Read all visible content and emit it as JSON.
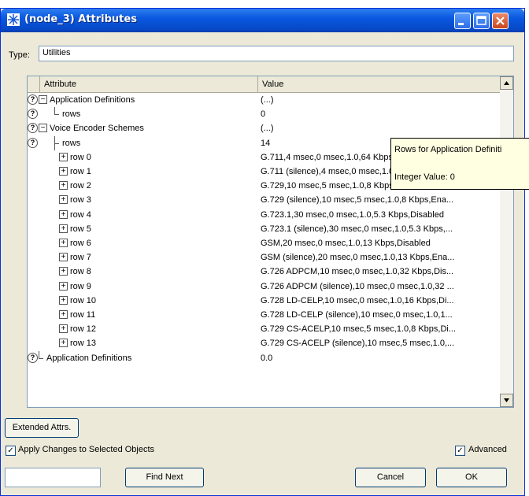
{
  "window": {
    "title": "(node_3) Attributes"
  },
  "type": {
    "label": "Type:",
    "value": "Utilities"
  },
  "table": {
    "header_attribute": "Attribute",
    "header_value": "Value",
    "rows": [
      {
        "label": "Application Definitions",
        "value": "(...)",
        "help": true,
        "toggle": "−"
      },
      {
        "label": "rows",
        "value": "0",
        "help": true
      },
      {
        "label": "Voice Encoder Schemes",
        "value": "(...)",
        "help": true,
        "toggle": "−"
      },
      {
        "label": "rows",
        "value": "14",
        "help": true
      },
      {
        "label": "row 0",
        "value": "G.711,4 msec,0 msec,1.0,64 Kbps,Disabled",
        "toggle": "+"
      },
      {
        "label": "row 1",
        "value": "G.711 (silence),4 msec,0 msec,1.0,64 Kbps,Ena...",
        "toggle": "+"
      },
      {
        "label": "row 2",
        "value": "G.729,10 msec,5 msec,1.0,8 Kbps,Disabled",
        "toggle": "+"
      },
      {
        "label": "row 3",
        "value": "G.729 (silence),10 msec,5 msec,1.0,8 Kbps,Ena...",
        "toggle": "+"
      },
      {
        "label": "row 4",
        "value": "G.723.1,30 msec,0 msec,1.0,5.3 Kbps,Disabled",
        "toggle": "+"
      },
      {
        "label": "row 5",
        "value": "G.723.1 (silence),30 msec,0 msec,1.0,5.3 Kbps,...",
        "toggle": "+"
      },
      {
        "label": "row 6",
        "value": "GSM,20 msec,0 msec,1.0,13 Kbps,Disabled",
        "toggle": "+"
      },
      {
        "label": "row 7",
        "value": "GSM (silence),20 msec,0 msec,1.0,13 Kbps,Ena...",
        "toggle": "+"
      },
      {
        "label": "row 8",
        "value": "G.726 ADPCM,10 msec,0 msec,1.0,32 Kbps,Dis...",
        "toggle": "+"
      },
      {
        "label": "row 9",
        "value": "G.726 ADPCM (silence),10 msec,0 msec,1.0,32 ...",
        "toggle": "+"
      },
      {
        "label": "row 10",
        "value": "G.728 LD-CELP,10 msec,0 msec,1.0,16 Kbps,Di...",
        "toggle": "+"
      },
      {
        "label": "row 11",
        "value": "G.728 LD-CELP (silence),10 msec,0 msec,1.0,1...",
        "toggle": "+"
      },
      {
        "label": "row 12",
        "value": "G.729 CS-ACELP,10 msec,5 msec,1.0,8 Kbps,Di...",
        "toggle": "+"
      },
      {
        "label": "row 13",
        "value": "G.729 CS-ACELP (silence),10 msec,5 msec,1.0,...",
        "toggle": "+"
      },
      {
        "label": "Application Definitions",
        "value": "0.0",
        "help": true
      }
    ]
  },
  "tooltip": {
    "line1": "Rows for Application Definiti",
    "line2": "Integer Value: 0"
  },
  "buttons": {
    "extended_attrs": "Extended Attrs.",
    "find_next": "Find Next",
    "cancel": "Cancel",
    "ok": "OK"
  },
  "options": {
    "apply_changes_label": "Apply Changes to Selected Objects",
    "apply_changes_checked": true,
    "advanced_label": "Advanced",
    "advanced_checked": true
  },
  "find": {
    "value": ""
  },
  "colors": {
    "title_bar": "#0a58e0",
    "dialog_bg": "#ece9d8",
    "tooltip_bg": "#ffffe1"
  },
  "icons": [
    "app-icon",
    "minimize-icon",
    "maximize-icon",
    "close-icon",
    "help-icon",
    "expand-icon",
    "collapse-icon",
    "scroll-up-icon",
    "scroll-down-icon",
    "checkmark-icon"
  ]
}
